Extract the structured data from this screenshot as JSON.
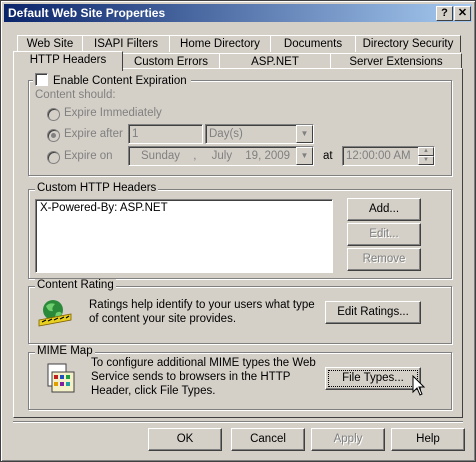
{
  "window": {
    "title": "Default Web Site Properties",
    "help_glyph": "?",
    "close_glyph": "✕"
  },
  "tabs_row1": [
    {
      "label": "Web Site"
    },
    {
      "label": "ISAPI Filters"
    },
    {
      "label": "Home Directory"
    },
    {
      "label": "Documents"
    },
    {
      "label": "Directory Security"
    }
  ],
  "tabs_row2": [
    {
      "label": "HTTP Headers",
      "active": true
    },
    {
      "label": "Custom Errors"
    },
    {
      "label": "ASP.NET"
    },
    {
      "label": "Server Extensions"
    }
  ],
  "expiration": {
    "checkbox_label": "Enable Content Expiration",
    "checked": false,
    "content_should": "Content should:",
    "expire_immediately": "Expire Immediately",
    "expire_after": "Expire after",
    "expire_after_value": "1",
    "unit": "Day(s)",
    "expire_on": "Expire on",
    "date_day": "Sunday",
    "date_sep": ",",
    "date_month": "July",
    "date_rest": "19, 2009",
    "at_label": "at",
    "time": "12:00:00 AM",
    "selected": "expire_after"
  },
  "custom_headers": {
    "group_label": "Custom HTTP Headers",
    "items": [
      "X-Powered-By: ASP.NET"
    ],
    "add": "Add...",
    "edit": "Edit...",
    "remove": "Remove"
  },
  "content_rating": {
    "group_label": "Content Rating",
    "description": "Ratings help identify to your users what type of content your site provides.",
    "button": "Edit Ratings..."
  },
  "mime_map": {
    "group_label": "MIME Map",
    "description": "To configure additional MIME types the Web Service sends to browsers in the HTTP Header, click File Types.",
    "button": "File Types..."
  },
  "footer": {
    "ok": "OK",
    "cancel": "Cancel",
    "apply": "Apply",
    "help": "Help"
  },
  "icons": {
    "content_rating": "ratings-icon",
    "mime_map": "file-types-icon",
    "cursor": "mouse-pointer-icon"
  }
}
